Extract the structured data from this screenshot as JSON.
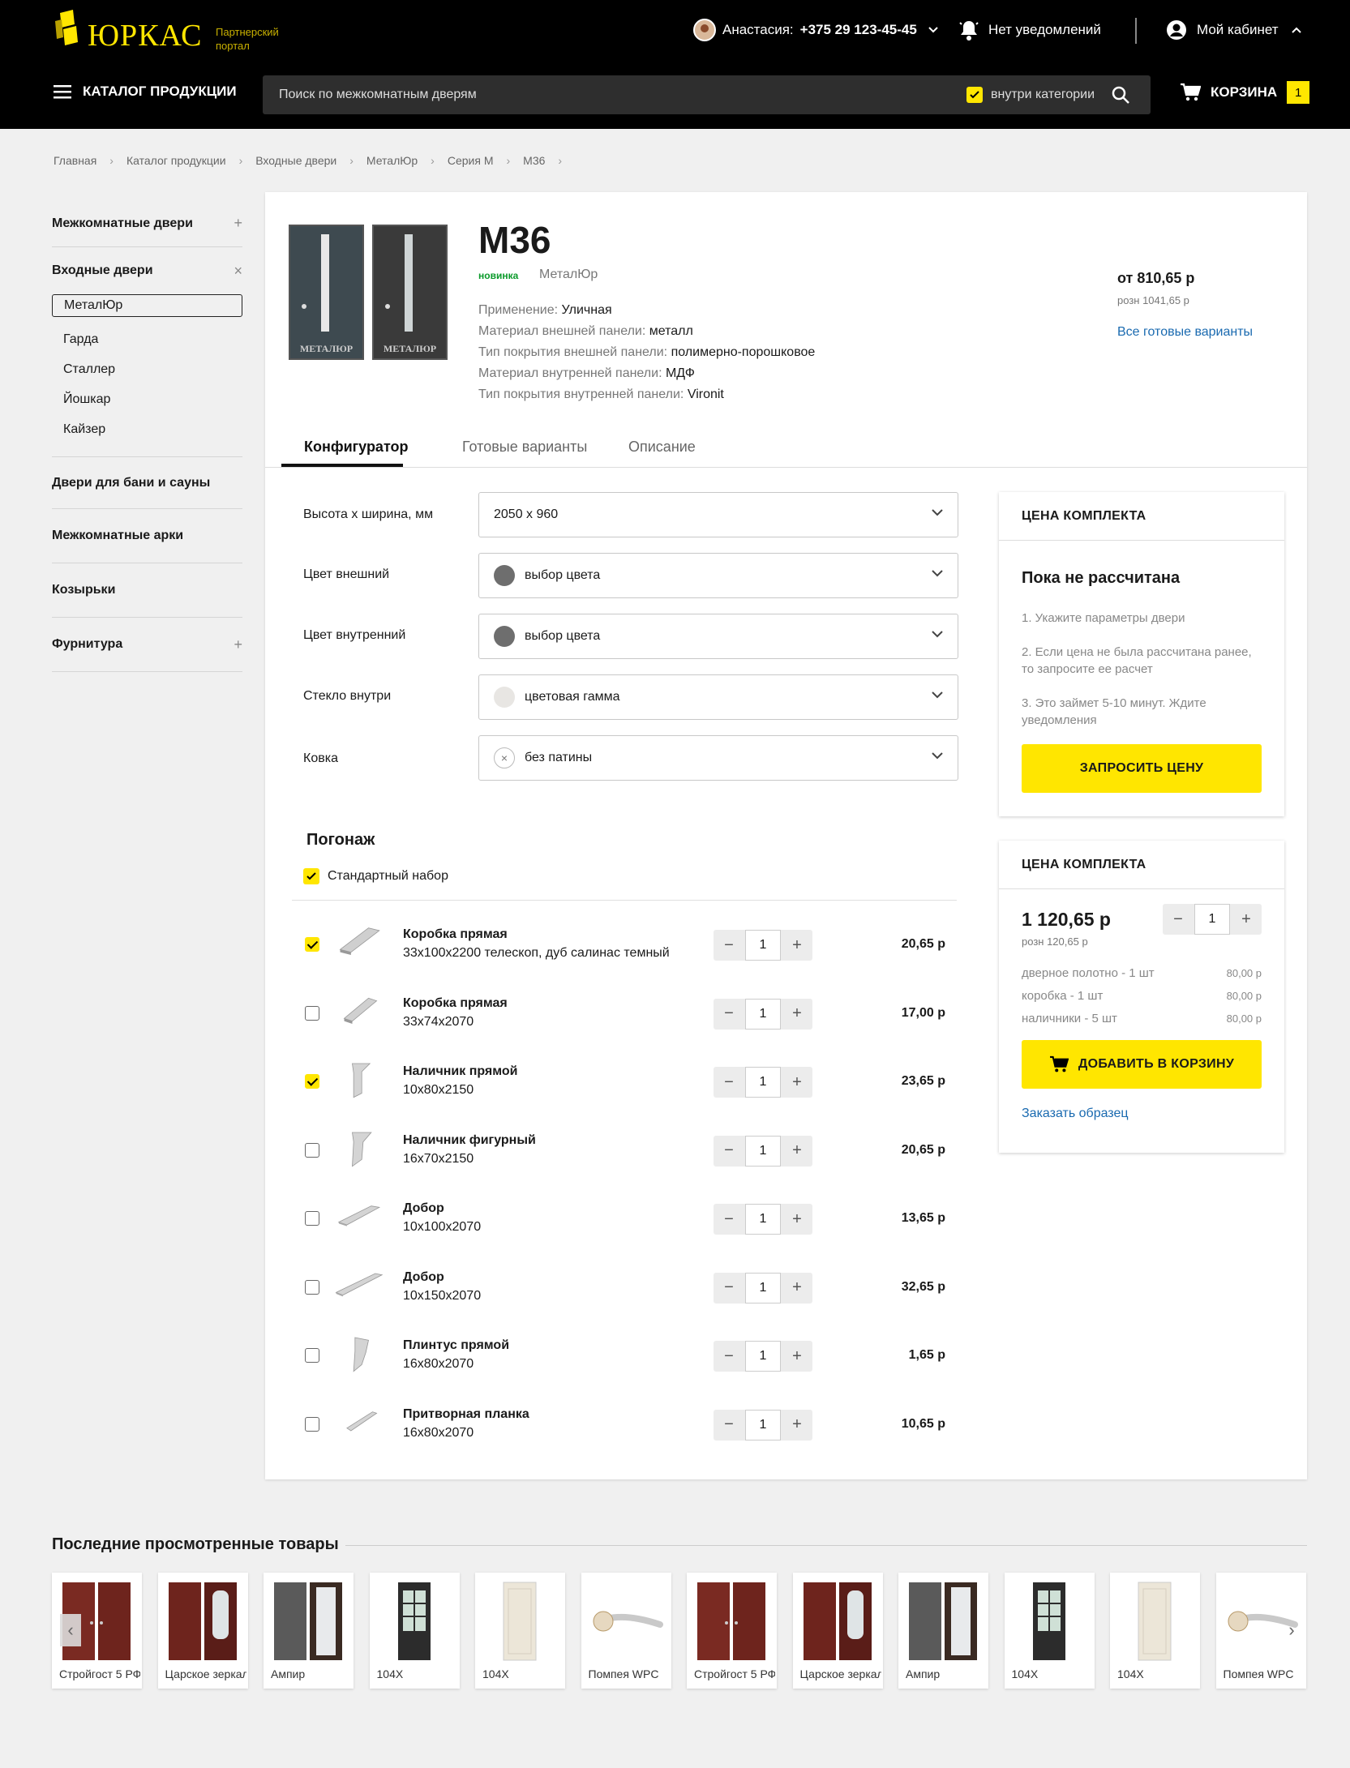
{
  "header": {
    "logo_text": "ЮРКАС",
    "logo_sub_1": "Партнерский",
    "logo_sub_2": "портал",
    "user_name": "Анастасия:",
    "user_phone": "+375 29 123-45-45",
    "notifications": "Нет уведомлений",
    "cabinet": "Мой кабинет",
    "catalog": "КАТАЛОГ ПРОДУКЦИИ",
    "search_placeholder": "Поиск по межкомнатным дверям",
    "inside_category": "внутри категории",
    "cart_label": "КОРЗИНА",
    "cart_count": "1"
  },
  "breadcrumb": [
    "Главная",
    "Каталог продукции",
    "Входные двери",
    "МеталЮр",
    "Серия М",
    "М36"
  ],
  "sidebar": {
    "cat_interior": "Межкомнатные двери",
    "cat_entrance": "Входные двери",
    "sub_items": [
      "МеталЮр",
      "Гарда",
      "Сталлер",
      "Йошкар",
      "Кайзер"
    ],
    "cat_bath": "Двери для бани и сауны",
    "cat_arches": "Межкомнатные арки",
    "cat_visors": "Козырьки",
    "cat_fittings": "Фурнитура"
  },
  "product": {
    "title": "М36",
    "badge": "новинка",
    "brand": "МеталЮр",
    "door_brand_1": "МЕТАЛЮР",
    "door_brand_2": "МЕТАЛЮР",
    "specs": [
      {
        "k": "Применение:",
        "v": "Уличная"
      },
      {
        "k": "Материал внешней панели:",
        "v": "металл"
      },
      {
        "k": "Тип покрытия внешней панели:",
        "v": "полимерно-порошковое"
      },
      {
        "k": "Материал внутренней панели:",
        "v": "МДФ"
      },
      {
        "k": "Тип покрытия внутренней панели:",
        "v": "Vironit"
      }
    ],
    "price_from": "от 810,65 р",
    "price_rozn": "розн 1041,65 р",
    "all_variants": "Все готовые варианты"
  },
  "tabs": [
    "Конфигуратор",
    "Готовые варианты",
    "Описание"
  ],
  "config": {
    "size_label": "Высота х ширина, мм",
    "size_value": "2050 х 960",
    "outer_label": "Цвет внешний",
    "outer_value": "выбор цвета",
    "inner_label": "Цвет внутренний",
    "inner_value": "выбор цвета",
    "glass_label": "Стекло внутри",
    "glass_value": "цветовая гамма",
    "forge_label": "Ковка",
    "forge_value": "без патины",
    "colors": {
      "outer": "#6e6e6e",
      "inner": "#6e6e6e",
      "glass": "#e8e6e3"
    }
  },
  "pogonazh": {
    "title": "Погонаж",
    "standard": "Стандартный набор",
    "items": [
      {
        "name": "Коробка прямая",
        "dim": "33х100х2200 телескоп, дуб салинас темный",
        "qty": "1",
        "price": "20,65 р",
        "checked": true
      },
      {
        "name": "Коробка прямая",
        "dim": "33х74х2070",
        "qty": "1",
        "price": "17,00 р",
        "checked": false
      },
      {
        "name": "Наличник прямой",
        "dim": "10х80х2150",
        "qty": "1",
        "price": "23,65 р",
        "checked": true
      },
      {
        "name": "Наличник фигурный",
        "dim": "16х70х2150",
        "qty": "1",
        "price": "20,65 р",
        "checked": false
      },
      {
        "name": "Добор",
        "dim": "10х100х2070",
        "qty": "1",
        "price": "13,65 р",
        "checked": false
      },
      {
        "name": "Добор",
        "dim": "10х150х2070",
        "qty": "1",
        "price": "32,65 р",
        "checked": false
      },
      {
        "name": "Плинтус прямой",
        "dim": "16х80х2070",
        "qty": "1",
        "price": "1,65 р",
        "checked": false
      },
      {
        "name": "Притворная планка",
        "dim": "16х80х2070",
        "qty": "1",
        "price": "10,65 р",
        "checked": false
      }
    ]
  },
  "panel1": {
    "header": "ЦЕНА КОМПЛЕКТА",
    "status": "Пока не рассчитана",
    "step1": "1. Укажите параметры двери",
    "step2": "2. Если цена не была рассчитана ранее, то запросите ее расчет",
    "step3": "3. Это займет 5-10 минут. Ждите уведомления",
    "button": "ЗАПРОСИТЬ ЦЕНУ"
  },
  "panel2": {
    "header": "ЦЕНА КОМПЛЕКТА",
    "total": "1 120,65 р",
    "rozn": "розн 120,65 р",
    "qty": "1",
    "lines": [
      {
        "k": "дверное полотно - 1 шт",
        "v": "80,00 р"
      },
      {
        "k": "коробка - 1 шт",
        "v": "80,00 р"
      },
      {
        "k": "наличники - 5 шт",
        "v": "80,00 р"
      }
    ],
    "button": "ДОБАВИТЬ В КОРЗИНУ",
    "sample": "Заказать образец"
  },
  "recent": {
    "title": "Последние просмотренные товары",
    "items": [
      {
        "label": "Стройгост 5 РФ",
        "kind": "door-red"
      },
      {
        "label": "Царское зеркало",
        "kind": "door-red-mirror"
      },
      {
        "label": "Ампир",
        "kind": "door-grey-mirror"
      },
      {
        "label": "104Х",
        "kind": "door-dark-glass"
      },
      {
        "label": "104Х",
        "kind": "door-cream"
      },
      {
        "label": "Помпея WPC",
        "kind": "handle"
      },
      {
        "label": "Стройгост 5 РФ",
        "kind": "door-red"
      },
      {
        "label": "Царское зеркало",
        "kind": "door-red-mirror"
      },
      {
        "label": "Ампир",
        "kind": "door-grey-mirror"
      },
      {
        "label": "104Х",
        "kind": "door-dark-glass"
      },
      {
        "label": "104Х",
        "kind": "door-cream"
      },
      {
        "label": "Помпея WPC",
        "kind": "handle"
      }
    ]
  },
  "colors": {
    "accent": "#ffe600",
    "link": "#1a6ab0",
    "badge": "#0a9a2a"
  }
}
